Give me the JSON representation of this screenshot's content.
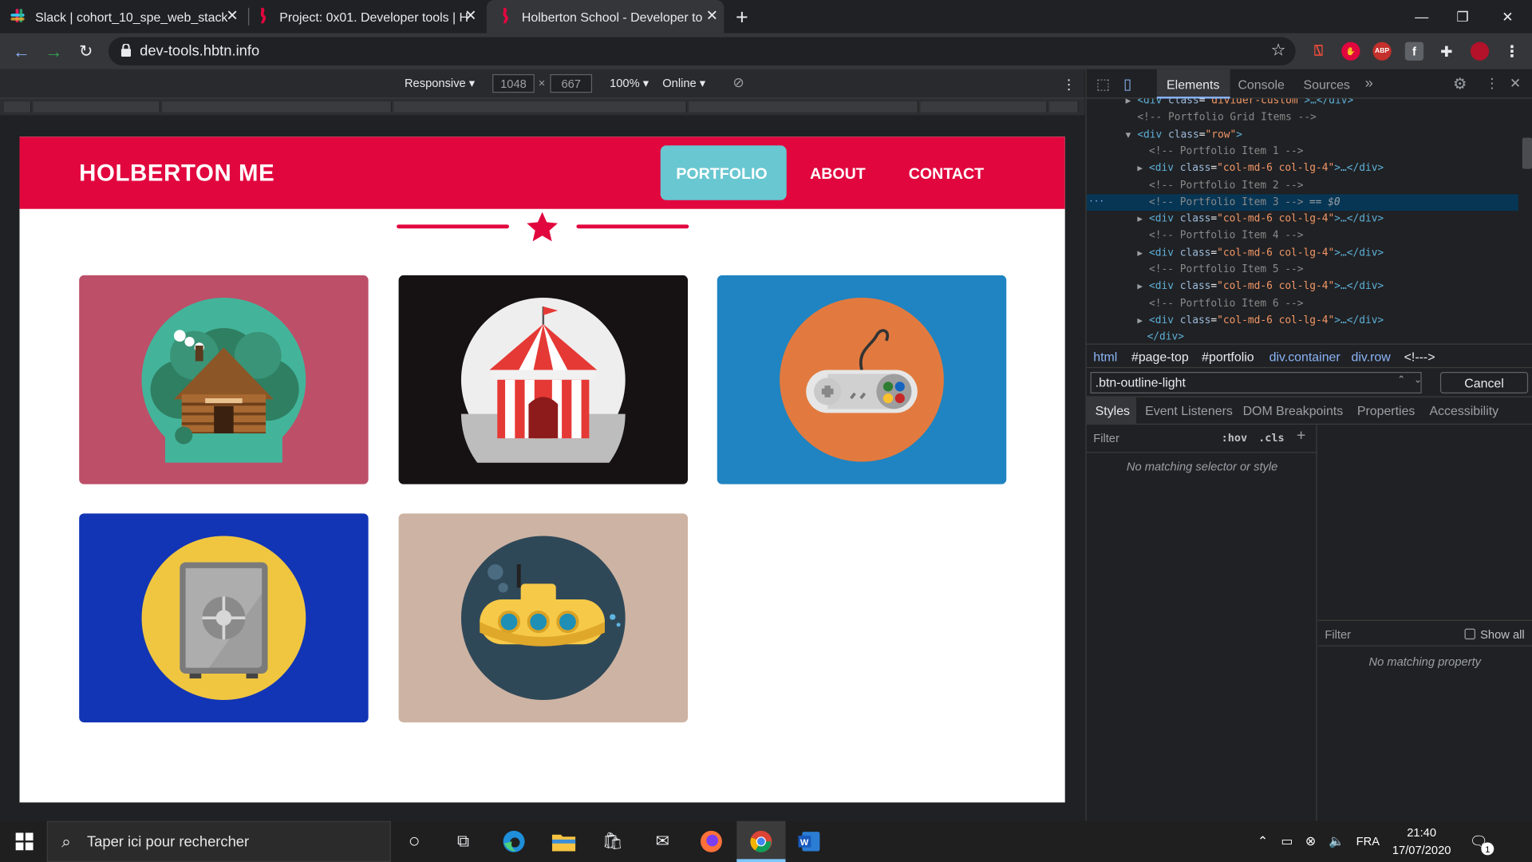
{
  "browser": {
    "tabs": [
      {
        "title": "Slack | cohort_10_spe_web_stack",
        "active": false
      },
      {
        "title": "Project: 0x01. Developer tools | H",
        "active": false
      },
      {
        "title": "Holberton School - Developer to",
        "active": true
      }
    ],
    "new_tab": "+",
    "url": "dev-tools.hbtn.info",
    "extensions": [
      "pdf-icon",
      "hand-stop-icon",
      "ABP",
      "facebook-icon",
      "puzzle-icon",
      "profile-avatar"
    ]
  },
  "device_toolbar": {
    "mode": "Responsive",
    "width": "1048",
    "height": "667",
    "zoom": "100%",
    "network": "Online"
  },
  "site": {
    "brand": "HOLBERTON ME",
    "nav": [
      {
        "label": "PORTFOLIO",
        "active": true
      },
      {
        "label": "ABOUT",
        "active": false
      },
      {
        "label": "CONTACT",
        "active": false
      }
    ],
    "accent": "#e1073e",
    "nav_active_bg": "#69c7d1",
    "portfolio": [
      {
        "image": "cabin-illustration",
        "bg": "#bd4f68"
      },
      {
        "image": "circus-tent-illustration",
        "bg": "#161214"
      },
      {
        "image": "game-controller-illustration",
        "bg": "#1f84c1"
      },
      {
        "image": "safe-illustration",
        "bg": "#1235b5"
      },
      {
        "image": "submarine-illustration",
        "bg": "#cdb3a3"
      }
    ]
  },
  "devtools": {
    "tabs": [
      "Elements",
      "Console",
      "Sources",
      "»"
    ],
    "dom": [
      {
        "text": "<div class=\"divider-custom\">…</div>",
        "depth": 0,
        "kind": "tag",
        "tag": "div",
        "attr": "class",
        "val": "divider-custom",
        "arrow": "▶",
        "suffix": ">…</div>"
      },
      {
        "text": "<!-- Portfolio Grid Items -->",
        "depth": 0,
        "kind": "comment"
      },
      {
        "tag": "div",
        "attr": "class",
        "val": "row",
        "depth": 0,
        "kind": "tag",
        "arrow": "▼",
        "suffix": ">"
      },
      {
        "text": "<!-- Portfolio Item 1 -->",
        "depth": 1,
        "kind": "comment"
      },
      {
        "tag": "div",
        "attr": "class",
        "val": "col-md-6 col-lg-4",
        "depth": 1,
        "kind": "tag",
        "arrow": "▶",
        "suffix": ">…</div>"
      },
      {
        "text": "<!-- Portfolio Item 2 -->",
        "depth": 1,
        "kind": "comment"
      },
      {
        "text": "<!-- Portfolio Item 3 -->",
        "depth": 1,
        "kind": "comment",
        "selected": true,
        "marker": "== $0"
      },
      {
        "tag": "div",
        "attr": "class",
        "val": "col-md-6 col-lg-4",
        "depth": 1,
        "kind": "tag",
        "arrow": "▶",
        "suffix": ">…</div>"
      },
      {
        "text": "<!-- Portfolio Item 4 -->",
        "depth": 1,
        "kind": "comment"
      },
      {
        "tag": "div",
        "attr": "class",
        "val": "col-md-6 col-lg-4",
        "depth": 1,
        "kind": "tag",
        "arrow": "▶",
        "suffix": ">…</div>"
      },
      {
        "text": "<!-- Portfolio Item 5 -->",
        "depth": 1,
        "kind": "comment"
      },
      {
        "tag": "div",
        "attr": "class",
        "val": "col-md-6 col-lg-4",
        "depth": 1,
        "kind": "tag",
        "arrow": "▶",
        "suffix": ">…</div>"
      },
      {
        "text": "<!-- Portfolio Item 6 -->",
        "depth": 1,
        "kind": "comment"
      },
      {
        "tag": "div",
        "attr": "class",
        "val": "col-md-6 col-lg-4",
        "depth": 1,
        "kind": "tag",
        "arrow": "▶",
        "suffix": ">…</div>"
      },
      {
        "text": "</div>",
        "depth": 0,
        "kind": "close"
      }
    ],
    "breadcrumb": [
      "html",
      "#page-top",
      "#portfolio",
      "div.container",
      "div.row",
      "<!--->"
    ],
    "search_value": ".btn-outline-light",
    "cancel_label": "Cancel",
    "subtabs": [
      "Styles",
      "Event Listeners",
      "DOM Breakpoints",
      "Properties",
      "Accessibility"
    ],
    "styles_filter": "Filter",
    "hov": ":hov",
    "cls": ".cls",
    "styles_empty": "No matching selector or style",
    "computed_filter": "Filter",
    "show_all": "Show all",
    "computed_empty": "No matching property"
  },
  "taskbar": {
    "search_placeholder": "Taper ici pour rechercher",
    "language": "FRA",
    "time": "21:40",
    "date": "17/07/2020",
    "notification_count": "1"
  }
}
